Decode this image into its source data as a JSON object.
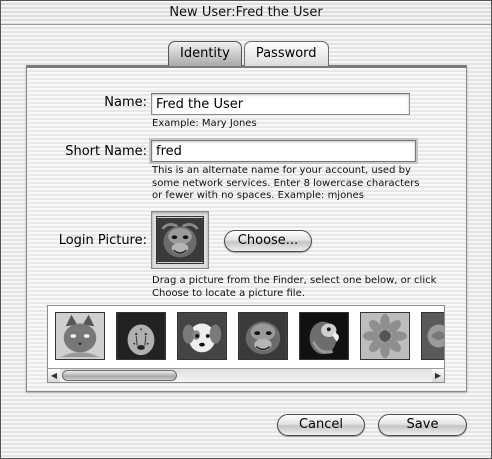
{
  "window": {
    "title": "New User:Fred the User"
  },
  "tabs": [
    {
      "label": "Identity",
      "active": true
    },
    {
      "label": "Password",
      "active": false
    }
  ],
  "identity": {
    "name_label": "Name:",
    "name_value": "Fred the User",
    "name_example": "Example: Mary Jones",
    "short_name_label": "Short Name:",
    "short_name_value": "fred",
    "short_name_help": [
      "This is an alternate name for your account, used by",
      "some network services. Enter 8 lowercase characters",
      "or fewer with no spaces. Example: mjones"
    ],
    "login_picture_label": "Login Picture:",
    "login_picture": "orangutan",
    "choose_label": "Choose...",
    "drag_help": [
      "Drag a picture from the Finder, select one below, or click",
      "Choose to locate a picture file."
    ],
    "pictures": [
      "cat",
      "cheetah",
      "puppy",
      "orangutan",
      "parrot",
      "flower",
      "rose"
    ]
  },
  "buttons": {
    "cancel": "Cancel",
    "save": "Save"
  }
}
